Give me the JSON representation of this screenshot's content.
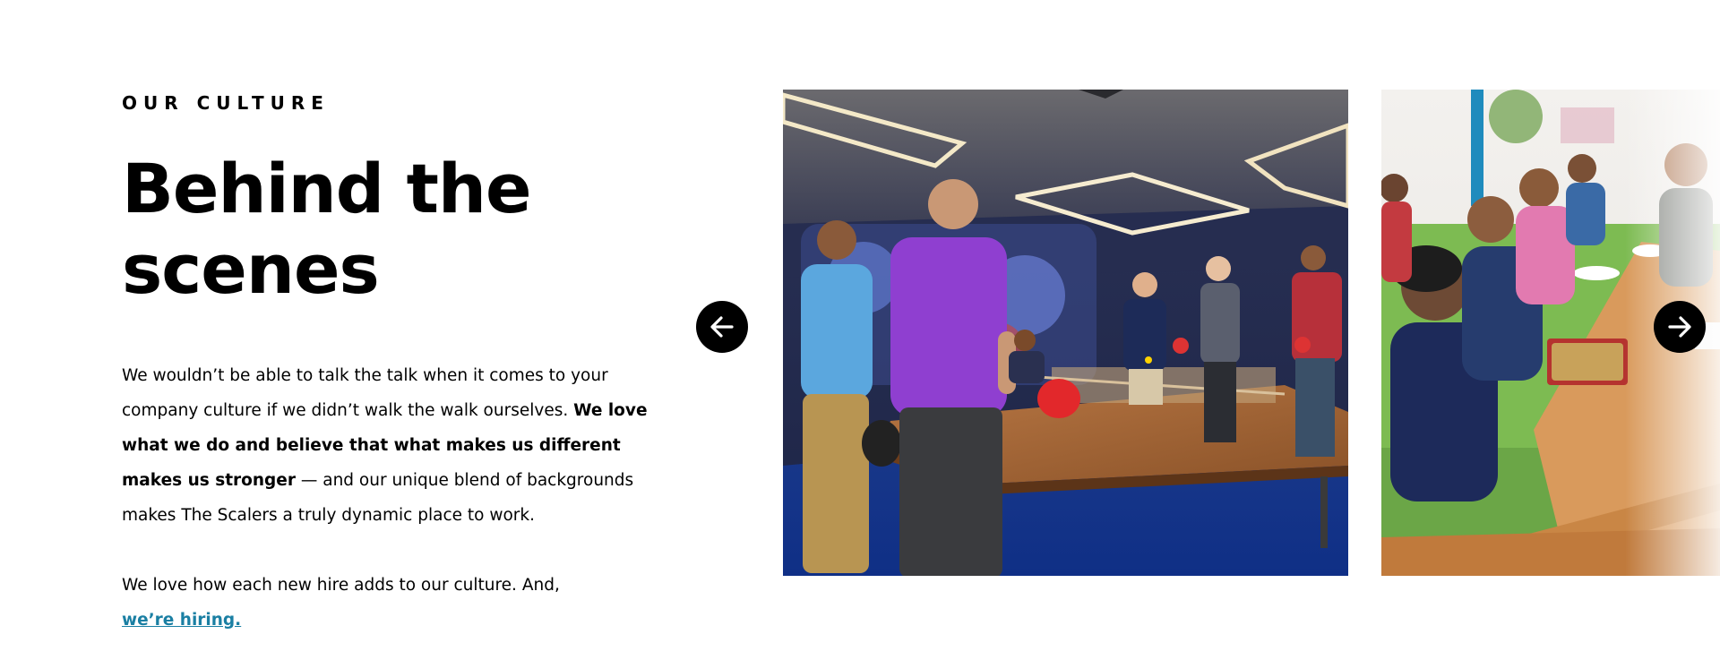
{
  "section": {
    "eyebrow": "OUR CULTURE",
    "title_line1": "Behind the",
    "title_line2": "scenes",
    "paragraph1": {
      "text_before": "We wouldn’t be able to talk the talk when it comes to your company culture if we didn’t walk the walk ourselves. ",
      "bold": "We love what we do and believe that what makes us different makes us stronger",
      "text_after": " — and our unique blend of backgrounds makes The Scalers a truly dynamic place to work."
    },
    "paragraph2": {
      "text": "We love how each new hire adds to our culture. And, ",
      "link": "we’re hiring."
    }
  },
  "carousel": {
    "slides": [
      {
        "image": "office-ping-pong-photo"
      },
      {
        "image": "outdoor-lunch-table-photo"
      }
    ],
    "prev_icon": "arrow-left-icon",
    "next_icon": "arrow-right-icon"
  },
  "colors": {
    "link": "#1a7fa3",
    "nav_button": "#000000"
  }
}
